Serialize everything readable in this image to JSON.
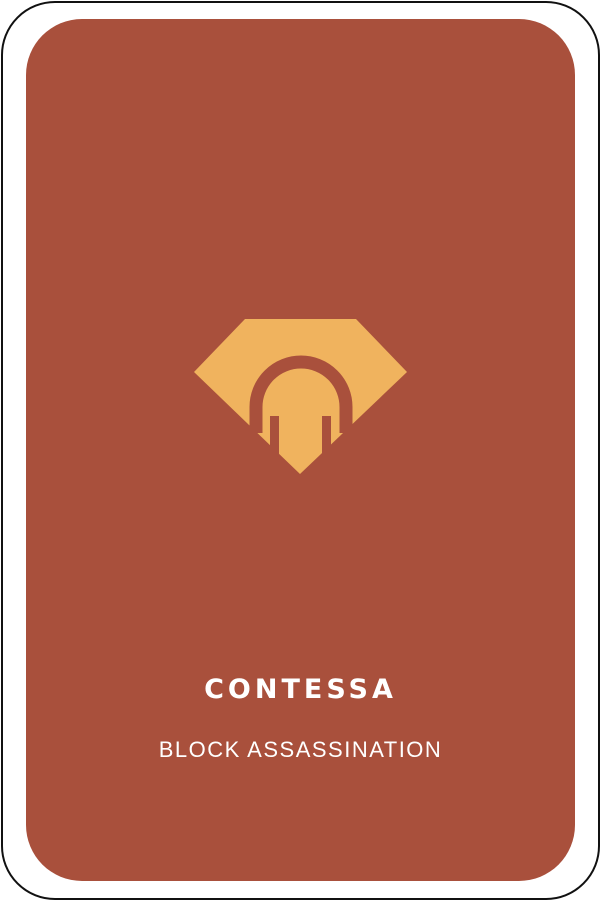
{
  "card": {
    "title": "CONTESSA",
    "action": "BLOCK ASSASSINATION",
    "emblem_icon": "contessa-gem-icon"
  },
  "colors": {
    "card_face": "#a9503c",
    "emblem": "#f0b35e",
    "text": "#ffffff",
    "outline": "#111111"
  }
}
